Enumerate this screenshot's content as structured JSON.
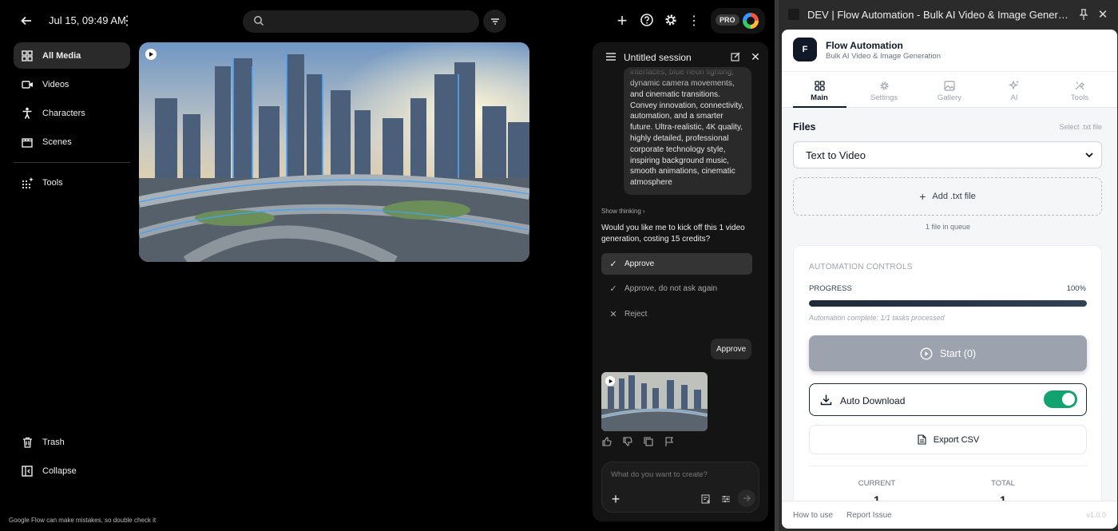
{
  "app": {
    "date_title": "Jul 15, 09:49 AM",
    "search_placeholder": "",
    "pro_badge": "PRO",
    "footnote": "Google Flow can make mistakes, so double check it"
  },
  "sidebar": {
    "items": [
      {
        "label": "All Media",
        "icon": "grid-icon",
        "active": true
      },
      {
        "label": "Videos",
        "icon": "video-camera-icon"
      },
      {
        "label": "Characters",
        "icon": "person-icon"
      },
      {
        "label": "Scenes",
        "icon": "clapperboard-icon"
      },
      {
        "label": "Tools",
        "icon": "sparkle-grid-icon"
      }
    ],
    "bottom": [
      {
        "label": "Trash",
        "icon": "trash-icon"
      },
      {
        "label": "Collapse",
        "icon": "collapse-icon"
      }
    ]
  },
  "chat": {
    "title": "Untitled session",
    "prompt_text": "interfaces, blue neon lighting, dynamic camera movements, and cinematic transitions. Convey innovation, connectivity, automation, and a smarter future. Ultra-realistic, 4K quality, highly detailed, professional corporate technology style, inspiring background music, smooth animations, cinematic atmosphere",
    "show_thinking": "Show thinking",
    "question": "Would you like me to kick off this 1 video generation, costing 15 credits?",
    "options": [
      {
        "label": "Approve",
        "icon": "check-icon",
        "selected": true
      },
      {
        "label": "Approve, do not ask again",
        "icon": "check-icon"
      },
      {
        "label": "Reject",
        "icon": "x-icon"
      }
    ],
    "user_reply": "Approve",
    "composer_placeholder": "What do you want to create?"
  },
  "side_panel": {
    "window_title": "DEV | Flow Automation - Bulk AI Video & Image Generation"
  },
  "extension": {
    "logo_letter": "F",
    "name": "Flow Automation",
    "subtitle": "Bulk AI Video & Image Generation",
    "tabs": [
      {
        "label": "Main",
        "icon": "grid-icon",
        "active": true
      },
      {
        "label": "Settings",
        "icon": "gear-icon"
      },
      {
        "label": "Gallery",
        "icon": "image-icon"
      },
      {
        "label": "AI",
        "icon": "sparkle-icon"
      },
      {
        "label": "Tools",
        "icon": "tools-icon"
      }
    ],
    "files_label": "Files",
    "select_txt": "Select .txt file",
    "mode_value": "Text to Video",
    "add_file_label": "Add .txt file",
    "queue_count": "1 file in queue",
    "controls_title": "AUTOMATION CONTROLS",
    "progress_label": "PROGRESS",
    "progress_pct": "100%",
    "progress_value": 1.0,
    "status": "Automation complete: 1/1 tasks processed",
    "start_label": "Start (0)",
    "auto_download_label": "Auto Download",
    "auto_download_on": true,
    "export_label": "Export CSV",
    "current_label": "CURRENT",
    "current_value": "1",
    "total_label": "TOTAL",
    "total_value": "1",
    "footer_links": [
      "How to use",
      "Report Issue"
    ],
    "version": "v1.0.0"
  },
  "colors": {
    "accent_dark": "#111827",
    "toggle_on": "#10a36f",
    "start_disabled": "#9ca3af"
  }
}
